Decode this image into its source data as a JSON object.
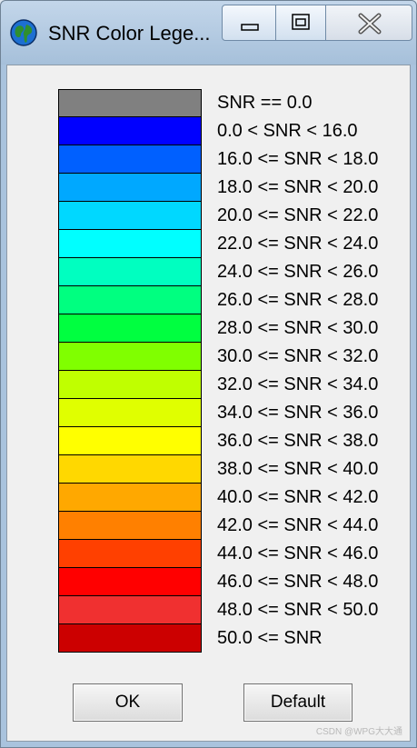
{
  "window": {
    "title": "SNR Color Lege...",
    "icon": "globe-icon",
    "controls": [
      "minimize-icon",
      "maximize-icon",
      "close-icon"
    ]
  },
  "legend": {
    "items": [
      {
        "label": "SNR == 0.0",
        "color": "#808080"
      },
      {
        "label": "0.0 < SNR < 16.0",
        "color": "#0000ff"
      },
      {
        "label": "16.0 <= SNR < 18.0",
        "color": "#0060ff"
      },
      {
        "label": "18.0 <= SNR < 20.0",
        "color": "#00a8ff"
      },
      {
        "label": "20.0 <= SNR < 22.0",
        "color": "#00d8ff"
      },
      {
        "label": "22.0 <= SNR < 24.0",
        "color": "#00ffff"
      },
      {
        "label": "24.0 <= SNR < 26.0",
        "color": "#00ffc0"
      },
      {
        "label": "26.0 <= SNR < 28.0",
        "color": "#00ff80"
      },
      {
        "label": "28.0 <= SNR < 30.0",
        "color": "#00ff40"
      },
      {
        "label": "30.0 <= SNR < 32.0",
        "color": "#80ff00"
      },
      {
        "label": "32.0 <= SNR < 34.0",
        "color": "#c0ff00"
      },
      {
        "label": "34.0 <= SNR < 36.0",
        "color": "#e0ff00"
      },
      {
        "label": "36.0 <= SNR < 38.0",
        "color": "#ffff00"
      },
      {
        "label": "38.0 <= SNR < 40.0",
        "color": "#ffd800"
      },
      {
        "label": "40.0 <= SNR < 42.0",
        "color": "#ffa800"
      },
      {
        "label": "42.0 <= SNR < 44.0",
        "color": "#ff8000"
      },
      {
        "label": "44.0 <= SNR < 46.0",
        "color": "#ff4000"
      },
      {
        "label": "46.0 <= SNR < 48.0",
        "color": "#ff0000"
      },
      {
        "label": "48.0 <= SNR < 50.0",
        "color": "#f03030"
      },
      {
        "label": "50.0 <= SNR",
        "color": "#cc0000"
      }
    ]
  },
  "buttons": {
    "ok_label": "OK",
    "default_label": "Default"
  },
  "watermark": "CSDN @WPG大大通"
}
